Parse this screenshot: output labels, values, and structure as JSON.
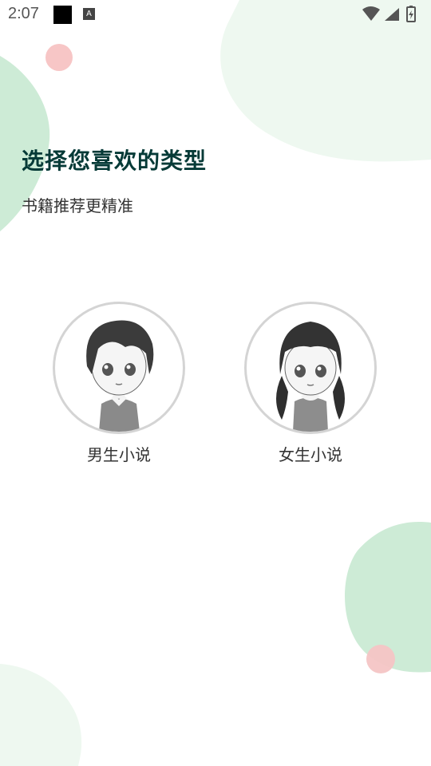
{
  "status_bar": {
    "time": "2:07",
    "notification_a": "A"
  },
  "header": {
    "title": "选择您喜欢的类型",
    "subtitle": "书籍推荐更精准"
  },
  "options": [
    {
      "label": "男生小说",
      "avatar": "boy-avatar-icon"
    },
    {
      "label": "女生小说",
      "avatar": "girl-avatar-icon"
    }
  ],
  "colors": {
    "blob_green": "#e7f6ea",
    "blob_green_dark": "#cdebd6",
    "dot_pink": "#f7c2c2",
    "title": "#063a37"
  }
}
